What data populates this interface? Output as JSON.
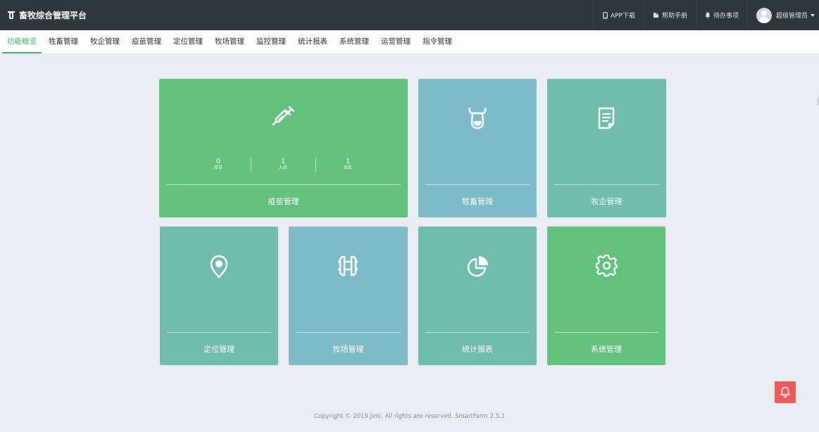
{
  "app": {
    "title": "畜牧综合管理平台"
  },
  "header": {
    "app_download": "APP下载",
    "help_manual": "帮助手册",
    "todo": "待办事项",
    "user": "超级管理员"
  },
  "nav": [
    {
      "label": "功能概览",
      "active": true
    },
    {
      "label": "牲畜管理"
    },
    {
      "label": "牧企管理"
    },
    {
      "label": "疫苗管理"
    },
    {
      "label": "定位管理"
    },
    {
      "label": "牧场管理"
    },
    {
      "label": "监控管理"
    },
    {
      "label": "统计报表"
    },
    {
      "label": "系统管理"
    },
    {
      "label": "运营管理"
    },
    {
      "label": "指令管理"
    }
  ],
  "cards": {
    "vaccine": {
      "label": "疫苗管理",
      "stats": [
        {
          "value": "0",
          "caption": "库存"
        },
        {
          "value": "1",
          "caption": "入库"
        },
        {
          "value": "1",
          "caption": "出库"
        }
      ]
    },
    "livestock": {
      "label": "牲畜管理"
    },
    "enterprise": {
      "label": "牧企管理"
    },
    "location": {
      "label": "定位管理"
    },
    "ranch": {
      "label": "牧场管理"
    },
    "stats": {
      "label": "统计报表"
    },
    "system": {
      "label": "系统管理"
    }
  },
  "footer": {
    "copyright": "Copyright © 2019 Jimi. All rights are reserved. SmartFarm 2.5.1"
  },
  "colors": {
    "green": "#62c27d",
    "blue": "#7dbbc8",
    "teal": "#6fbdaa",
    "header": "#31363c",
    "accent": "#4caf6a",
    "alert": "#ef5a5a"
  }
}
